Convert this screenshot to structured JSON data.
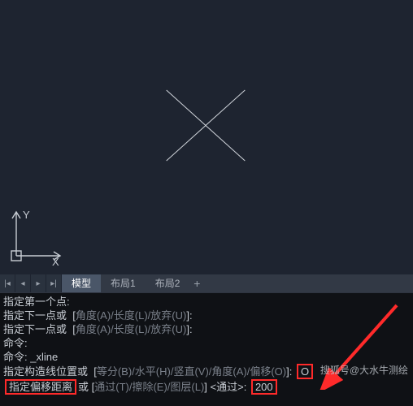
{
  "axes": {
    "x_label": "X",
    "y_label": "Y"
  },
  "tabs": {
    "model": "模型",
    "layout1": "布局1",
    "layout2": "布局2",
    "add": "+"
  },
  "cmd": {
    "l1": "指定第一个点:",
    "l2a": "指定下一点或  [",
    "l2b": "角度(A)/长度(L)/放弃(U)",
    "l2c": "]:",
    "l3a": "指定下一点或  [",
    "l3b": "角度(A)/长度(L)/放弃(U)",
    "l3c": "]:",
    "l4": "命令:",
    "l5": "命令: _xline",
    "l6a": "指定构造线位置或  [",
    "l6b": "等分(B)/水平(H)/竖直(V)/角度(A)/偏移(O)",
    "l6c": "]:",
    "l6v": "O",
    "l7a": "指定偏移距离",
    "l7b": "或 [",
    "l7c": "通过(T)/擦除(E)/图层(L)",
    "l7d": "] <通过>:",
    "l7v": "200"
  },
  "watermark": "搜狐号@大水牛测绘"
}
